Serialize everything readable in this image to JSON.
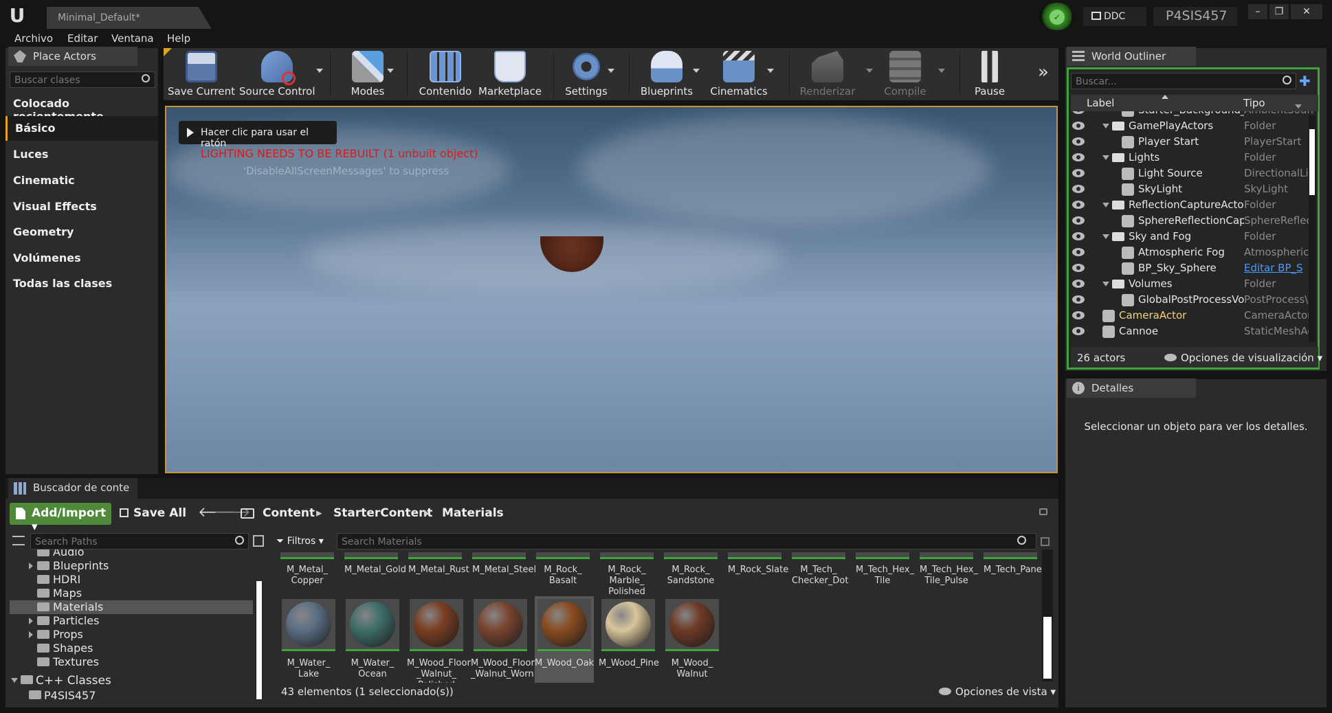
{
  "title_bar": {
    "logo": "U",
    "tab_title": "Minimal_Default*",
    "ddc_label": "DDC",
    "project_name": "P4SIS457",
    "window_buttons": [
      "–",
      "❐",
      "✕"
    ]
  },
  "menu": [
    "Archivo",
    "Editar",
    "Ventana",
    "Help"
  ],
  "place_actors": {
    "tab": "Place Actors",
    "search_placeholder": "Buscar clases",
    "categories": [
      "Colocado recientemente",
      "Básico",
      "Luces",
      "Cinematic",
      "Visual Effects",
      "Geometry",
      "Volúmenes",
      "Todas las clases"
    ],
    "selected": "Básico"
  },
  "toolbar": [
    {
      "label": "Save Current",
      "icon": "save-icon",
      "dropdown": false,
      "disabled": false
    },
    {
      "label": "Source Control",
      "icon": "source-control-icon",
      "dropdown": true,
      "disabled": false
    },
    {
      "label": "Modes",
      "icon": "modes-icon",
      "dropdown": true,
      "disabled": false
    },
    {
      "label": "Contenido",
      "icon": "content-icon",
      "dropdown": false,
      "disabled": false
    },
    {
      "label": "Marketplace",
      "icon": "marketplace-icon",
      "dropdown": false,
      "disabled": false
    },
    {
      "label": "Settings",
      "icon": "settings-icon",
      "dropdown": true,
      "disabled": false
    },
    {
      "label": "Blueprints",
      "icon": "blueprints-icon",
      "dropdown": true,
      "disabled": false
    },
    {
      "label": "Cinematics",
      "icon": "cinematics-icon",
      "dropdown": true,
      "disabled": false
    },
    {
      "label": "Renderizar",
      "icon": "build-icon",
      "dropdown": true,
      "disabled": true
    },
    {
      "label": "Compile",
      "icon": "compile-icon",
      "dropdown": true,
      "disabled": true
    },
    {
      "label": "Pause",
      "icon": "pause-icon",
      "dropdown": false,
      "disabled": false
    }
  ],
  "viewport": {
    "click_hint": "Hacer clic para usar el ratón",
    "warning": "LIGHTING NEEDS TO BE REBUILT (1 unbuilt object)",
    "suppress_hint": "'DisableAllScreenMessages' to suppress"
  },
  "outliner": {
    "tab": "World Outliner",
    "search_placeholder": "Buscar...",
    "col_label": "Label",
    "col_type": "Tipo",
    "rows": [
      {
        "label": "Starter_Background_C",
        "type": "AmbientSoun",
        "indent": 2,
        "kind": "actor",
        "partial": true
      },
      {
        "label": "GamePlayActors",
        "type": "Folder",
        "indent": 1,
        "kind": "folder"
      },
      {
        "label": "Player Start",
        "type": "PlayerStart",
        "indent": 2,
        "kind": "actor"
      },
      {
        "label": "Lights",
        "type": "Folder",
        "indent": 1,
        "kind": "folder"
      },
      {
        "label": "Light Source",
        "type": "DirectionalLig",
        "indent": 2,
        "kind": "actor"
      },
      {
        "label": "SkyLight",
        "type": "SkyLight",
        "indent": 2,
        "kind": "actor"
      },
      {
        "label": "ReflectionCaptureActors",
        "type": "Folder",
        "indent": 1,
        "kind": "folder"
      },
      {
        "label": "SphereReflectionCapt",
        "type": "SphereReflec",
        "indent": 2,
        "kind": "actor"
      },
      {
        "label": "Sky and Fog",
        "type": "Folder",
        "indent": 1,
        "kind": "folder"
      },
      {
        "label": "Atmospheric Fog",
        "type": "AtmosphericF",
        "indent": 2,
        "kind": "actor"
      },
      {
        "label": "BP_Sky_Sphere",
        "type": "Editar BP_S",
        "indent": 2,
        "kind": "actor",
        "link": true
      },
      {
        "label": "Volumes",
        "type": "Folder",
        "indent": 1,
        "kind": "folder"
      },
      {
        "label": "GlobalPostProcessVo",
        "type": "PostProcess\\",
        "indent": 2,
        "kind": "actor"
      },
      {
        "label": "CameraActor",
        "type": "CameraActor",
        "indent": 0,
        "kind": "actor",
        "highlight": true
      },
      {
        "label": "Cannoe",
        "type": "StaticMeshAc",
        "indent": 0,
        "kind": "actor"
      }
    ],
    "actor_count": "26 actors",
    "view_options": "Opciones de visualización"
  },
  "details": {
    "tab": "Detalles",
    "empty_message": "Seleccionar un objeto para ver los detalles."
  },
  "content_browser": {
    "tab": "Buscador de conte",
    "add_import": "Add/Import",
    "save_all": "Save All",
    "breadcrumb": [
      "Content",
      "StarterContent",
      "Materials"
    ],
    "search_paths_placeholder": "Search Paths",
    "filters": "Filtros",
    "search_materials_placeholder": "Search Materials",
    "tree": [
      {
        "label": "Audio",
        "indent": 1,
        "arrow": false,
        "partial": true
      },
      {
        "label": "Blueprints",
        "indent": 1,
        "arrow": true
      },
      {
        "label": "HDRI",
        "indent": 1,
        "arrow": false
      },
      {
        "label": "Maps",
        "indent": 1,
        "arrow": false
      },
      {
        "label": "Materials",
        "indent": 1,
        "arrow": false,
        "selected": true
      },
      {
        "label": "Particles",
        "indent": 1,
        "arrow": true
      },
      {
        "label": "Props",
        "indent": 1,
        "arrow": true
      },
      {
        "label": "Shapes",
        "indent": 1,
        "arrow": false
      },
      {
        "label": "Textures",
        "indent": 1,
        "arrow": false
      }
    ],
    "cpp_classes": "C++ Classes",
    "cpp_project": "P4SIS457",
    "assets_row1": [
      "M_Metal_\nCopper",
      "M_Metal_Gold",
      "M_Metal_Rust",
      "M_Metal_Steel",
      "M_Rock_\nBasalt",
      "M_Rock_\nMarble_\nPolished",
      "M_Rock_\nSandstone",
      "M_Rock_Slate",
      "M_Tech_\nChecker_Dot",
      "M_Tech_Hex_\nTile",
      "M_Tech_Hex_\nTile_Pulse",
      "M_Tech_Panel"
    ],
    "assets_row2": [
      {
        "name": "M_Water_\nLake",
        "color": "#5c6f85"
      },
      {
        "name": "M_Water_\nOcean",
        "color": "#3f6e6a"
      },
      {
        "name": "M_Wood_Floor\n_Walnut_\nPolished",
        "color": "#7a3e22"
      },
      {
        "name": "M_Wood_Floor\n_Walnut_Worn",
        "color": "#7a4530"
      },
      {
        "name": "M_Wood_Oak",
        "color": "#8a4c20",
        "selected": true
      },
      {
        "name": "M_Wood_Pine",
        "color": "#d9c59a"
      },
      {
        "name": "M_Wood_\nWalnut",
        "color": "#6e3a26"
      }
    ],
    "status": "43 elementos (1 seleccionado(s))",
    "view_options": "Opciones de vista"
  },
  "colors": {
    "accent": "#e1a520",
    "green": "#4e8a3a",
    "warning_red": "#e01818",
    "link_blue": "#4a9bff"
  }
}
